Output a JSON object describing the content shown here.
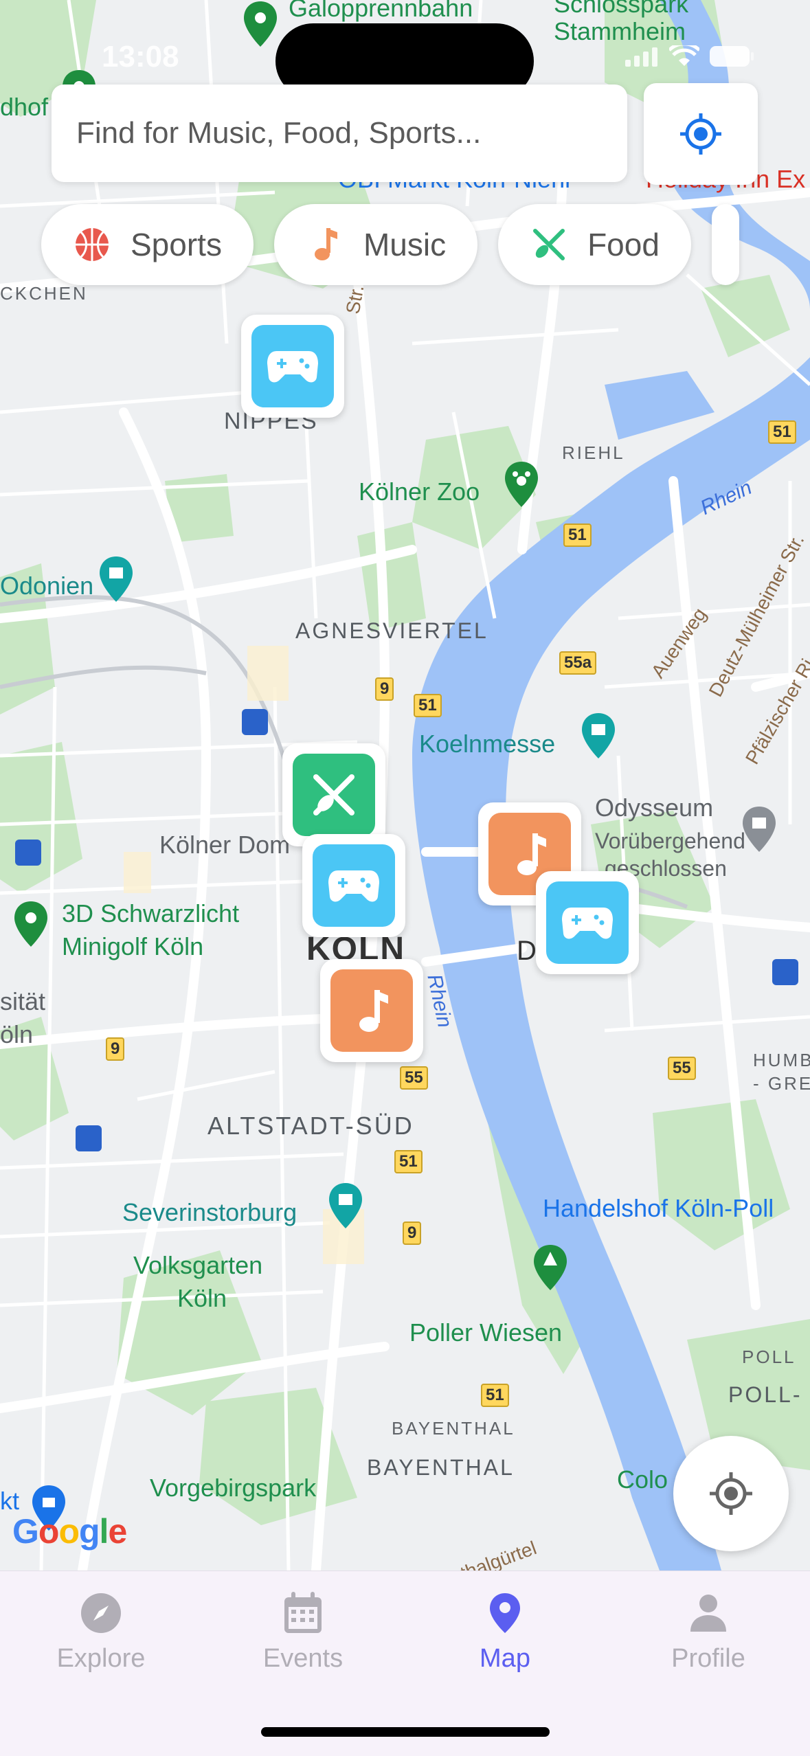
{
  "status": {
    "time": "13:08"
  },
  "search": {
    "placeholder": "Find for Music, Food, Sports..."
  },
  "chips": [
    {
      "label": "Sports",
      "icon": "basketball-icon"
    },
    {
      "label": "Music",
      "icon": "music-note-icon"
    },
    {
      "label": "Food",
      "icon": "fork-spoon-icon"
    }
  ],
  "map": {
    "labels": {
      "galopprennbahn": "Galopprennbahn",
      "schlosspark": "Schlosspark",
      "stammheim": "Stammheim",
      "dhof": "dhof",
      "obi": "OBI Markt Köln-Niehl",
      "holiday": "Holiday Inn Ex",
      "nippes_top": "NIPPES",
      "ckchen": "CKCHEN",
      "nippes": "NIPPES",
      "riehl": "RIEHL",
      "zoo": "Kölner Zoo",
      "rhein1": "Rhein",
      "donien": "Odonien",
      "agnesviertel": "AGNESVIERTEL",
      "auenweg": "Auenweg",
      "deutz_str": "Deutz-Mülheimer Str.",
      "koelnmesse": "Koelnmesse",
      "pfaelz": "Pfälzischer Ri",
      "odysseum": "Odysseum",
      "odysseum2": "Vorübergehend",
      "odysseum3": "geschlossen",
      "koelner_dom": "Kölner Dom",
      "minigolf1": "3D Schwarzlicht",
      "minigolf2": "Minigolf Köln",
      "koeln": "KÖLN",
      "deutz": "D",
      "rhein2": "Rhein",
      "sitaet": "sität",
      "oln": "öln",
      "humb": "HUMB",
      "gren": "- GREN",
      "altstadt": "ALTSTADT-SÜD",
      "severin": "Severinstorburg",
      "handelshof": "Handelshof Köln-Poll",
      "volksgarten1": "Volksgarten",
      "volksgarten2": "Köln",
      "poller": "Poller Wiesen",
      "poll_small": "POLL",
      "poll": "POLL-",
      "bayenthal_small": "BAYENTHAL",
      "bayenthal": "BAYENTHAL",
      "vorgebirg": "Vorgebirgspark",
      "colo": "Colo",
      "kt": "kt",
      "gurtel": "thalgürtel",
      "nippes_str": "Str."
    },
    "shields": [
      "51",
      "51",
      "55a",
      "9",
      "51",
      "9",
      "55",
      "55",
      "51",
      "9",
      "51"
    ],
    "google": [
      "G",
      "o",
      "o",
      "g",
      "l",
      "e"
    ],
    "colors": {
      "water": "#9ec2f7",
      "park": "#c5e8c5",
      "road": "#ffffff"
    }
  },
  "markers": [
    {
      "type": "game",
      "icon": "gamepad-icon"
    },
    {
      "type": "food",
      "icon": "fork-spoon-icon"
    },
    {
      "type": "game",
      "icon": "gamepad-icon"
    },
    {
      "type": "music",
      "icon": "music-note-icon"
    },
    {
      "type": "game",
      "icon": "gamepad-icon"
    },
    {
      "type": "music",
      "icon": "music-note-icon"
    }
  ],
  "tabs": [
    {
      "label": "Explore",
      "icon": "compass-icon",
      "active": false
    },
    {
      "label": "Events",
      "icon": "calendar-icon",
      "active": false
    },
    {
      "label": "Map",
      "icon": "map-pin-icon",
      "active": true
    },
    {
      "label": "Profile",
      "icon": "person-icon",
      "active": false
    }
  ],
  "accent": "#5b5ef0"
}
